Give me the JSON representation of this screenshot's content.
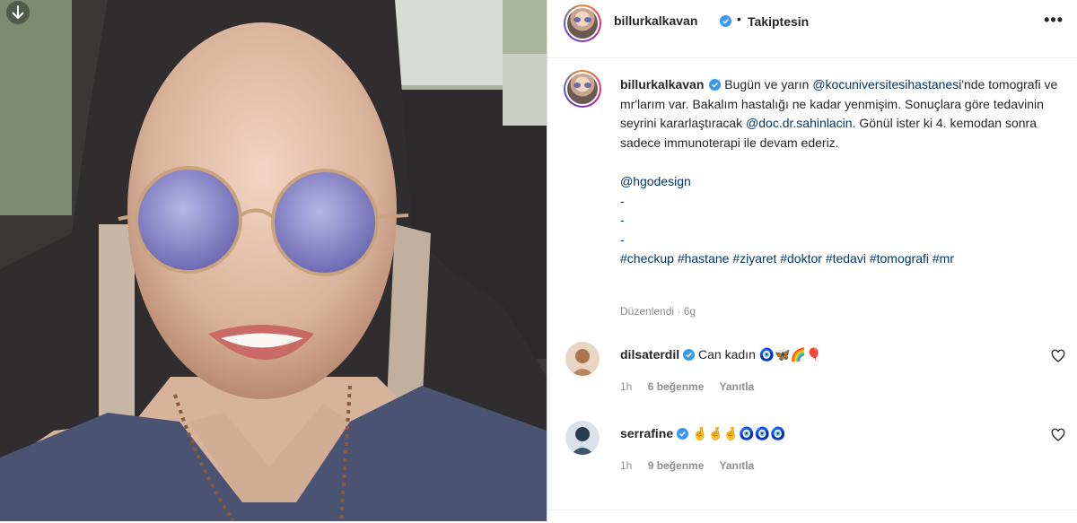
{
  "post": {
    "username": "billurkalkavan",
    "follow_status": "Takiptesin",
    "more_label": "•••",
    "header_separator": "•",
    "caption": {
      "line1_a": "Bugün ve yarın ",
      "mention1": "@kocuniversitesihastanesi",
      "line1_b": "'nde tomografi ve mr'larım var. Bakalım hastalığı ne kadar yenmişim. Sonuçlara göre tedavinin seyrini kararlaştıracak ",
      "mention2": "@doc.dr.sahinlacin",
      "line1_c": ". Gönül ister ki 4. kemodan sonra sadece immunoterapi ile devam ederiz.",
      "mention3": "@hgodesign",
      "dash1": "-",
      "dash2": "-",
      "dash3": "-",
      "hashtags": "#checkup #hastane #ziyaret #doktor #tedavi #tomografi #mr"
    },
    "edited_label": "Düzenlendi · 6g"
  },
  "comments": [
    {
      "username": "dilsaterdil",
      "text": "Can kadın",
      "emojis": "🧿🦋🌈🎈",
      "time": "1h",
      "likes": "6 beğenme",
      "reply": "Yanıtla"
    },
    {
      "username": "serrafine",
      "text": "",
      "emojis": "🤞🤞🤞🧿🧿🧿",
      "time": "1h",
      "likes": "9 beğenme",
      "reply": "Yanıtla"
    }
  ],
  "colors": {
    "link": "#00376b",
    "verified": "#3897f0",
    "muted": "#8e8e8e"
  },
  "icons": [
    "verified-badge-icon",
    "more-options-icon",
    "heart-icon",
    "download-icon"
  ]
}
